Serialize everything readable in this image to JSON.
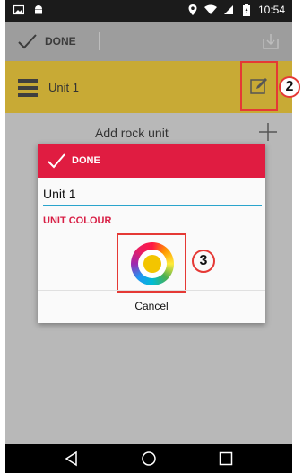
{
  "status_bar": {
    "time": "10:54",
    "icons": [
      "image-icon",
      "android-icon",
      "location-icon",
      "wifi-icon",
      "signal-icon",
      "battery-icon"
    ]
  },
  "app_bar": {
    "done_label": "DONE",
    "download_icon": "download-icon"
  },
  "unit_row": {
    "label": "Unit 1",
    "row_color": "#c8aa35",
    "edit_icon": "edit-icon"
  },
  "add_row": {
    "label": "Add rock unit",
    "plus_icon": "plus-icon"
  },
  "dialog": {
    "done_label": "DONE",
    "name_value": "Unit 1",
    "section_label": "UNIT COLOUR",
    "cancel_label": "Cancel",
    "header_color": "#e01c41",
    "accent_color": "#d81f45",
    "selected_colour": "#f3c500"
  },
  "callouts": {
    "edit": "2",
    "picker": "3"
  },
  "nav_bar": {
    "icons": [
      "back-icon",
      "home-icon",
      "recents-icon"
    ]
  }
}
